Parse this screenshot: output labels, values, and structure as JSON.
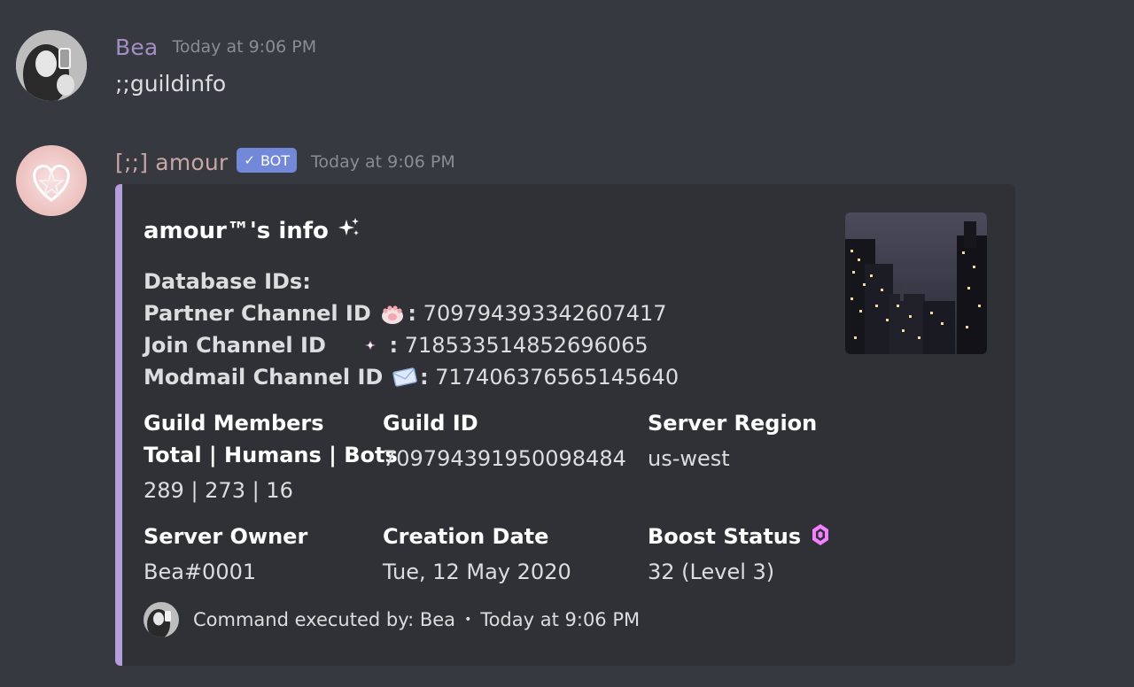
{
  "messages": [
    {
      "username": "Bea",
      "username_color": "#a38fc4",
      "timestamp": "Today at 9:06 PM",
      "content": ";;guildinfo"
    },
    {
      "username": "[;;] amour",
      "username_color": "#c9a6a6",
      "bot_tag": "BOT",
      "timestamp": "Today at 9:06 PM"
    }
  ],
  "embed": {
    "accent_color": "#b39ddb",
    "title": "amour™'s info",
    "title_icon": "sparkles-icon",
    "database_heading": "Database IDs:",
    "database_rows": [
      {
        "label": "Partner Channel ID",
        "icon": "paw-icon",
        "value": "709794393342607417"
      },
      {
        "label": "Join Channel ID",
        "icon": "sparkle-dot-icon",
        "value": "718533514852696065"
      },
      {
        "label": "Modmail Channel ID",
        "icon": "envelope-icon",
        "value": "717406376565145640"
      }
    ],
    "fields": [
      {
        "name": "Guild Members",
        "sub": "Total | Humans | Bots",
        "value": "289 | 273 | 16"
      },
      {
        "name": "Guild ID",
        "value": "709794391950098484"
      },
      {
        "name": "Server Region",
        "value": "us-west"
      },
      {
        "name": "Server Owner",
        "value": "Bea#0001"
      },
      {
        "name": "Creation Date",
        "value": "Tue, 12 May 2020"
      },
      {
        "name": "Boost Status",
        "icon": "boost-gem-icon",
        "value": "32 (Level 3)"
      }
    ],
    "footer": {
      "text": "Command executed by: Bea",
      "separator": "•",
      "timestamp": "Today at 9:06 PM"
    }
  }
}
